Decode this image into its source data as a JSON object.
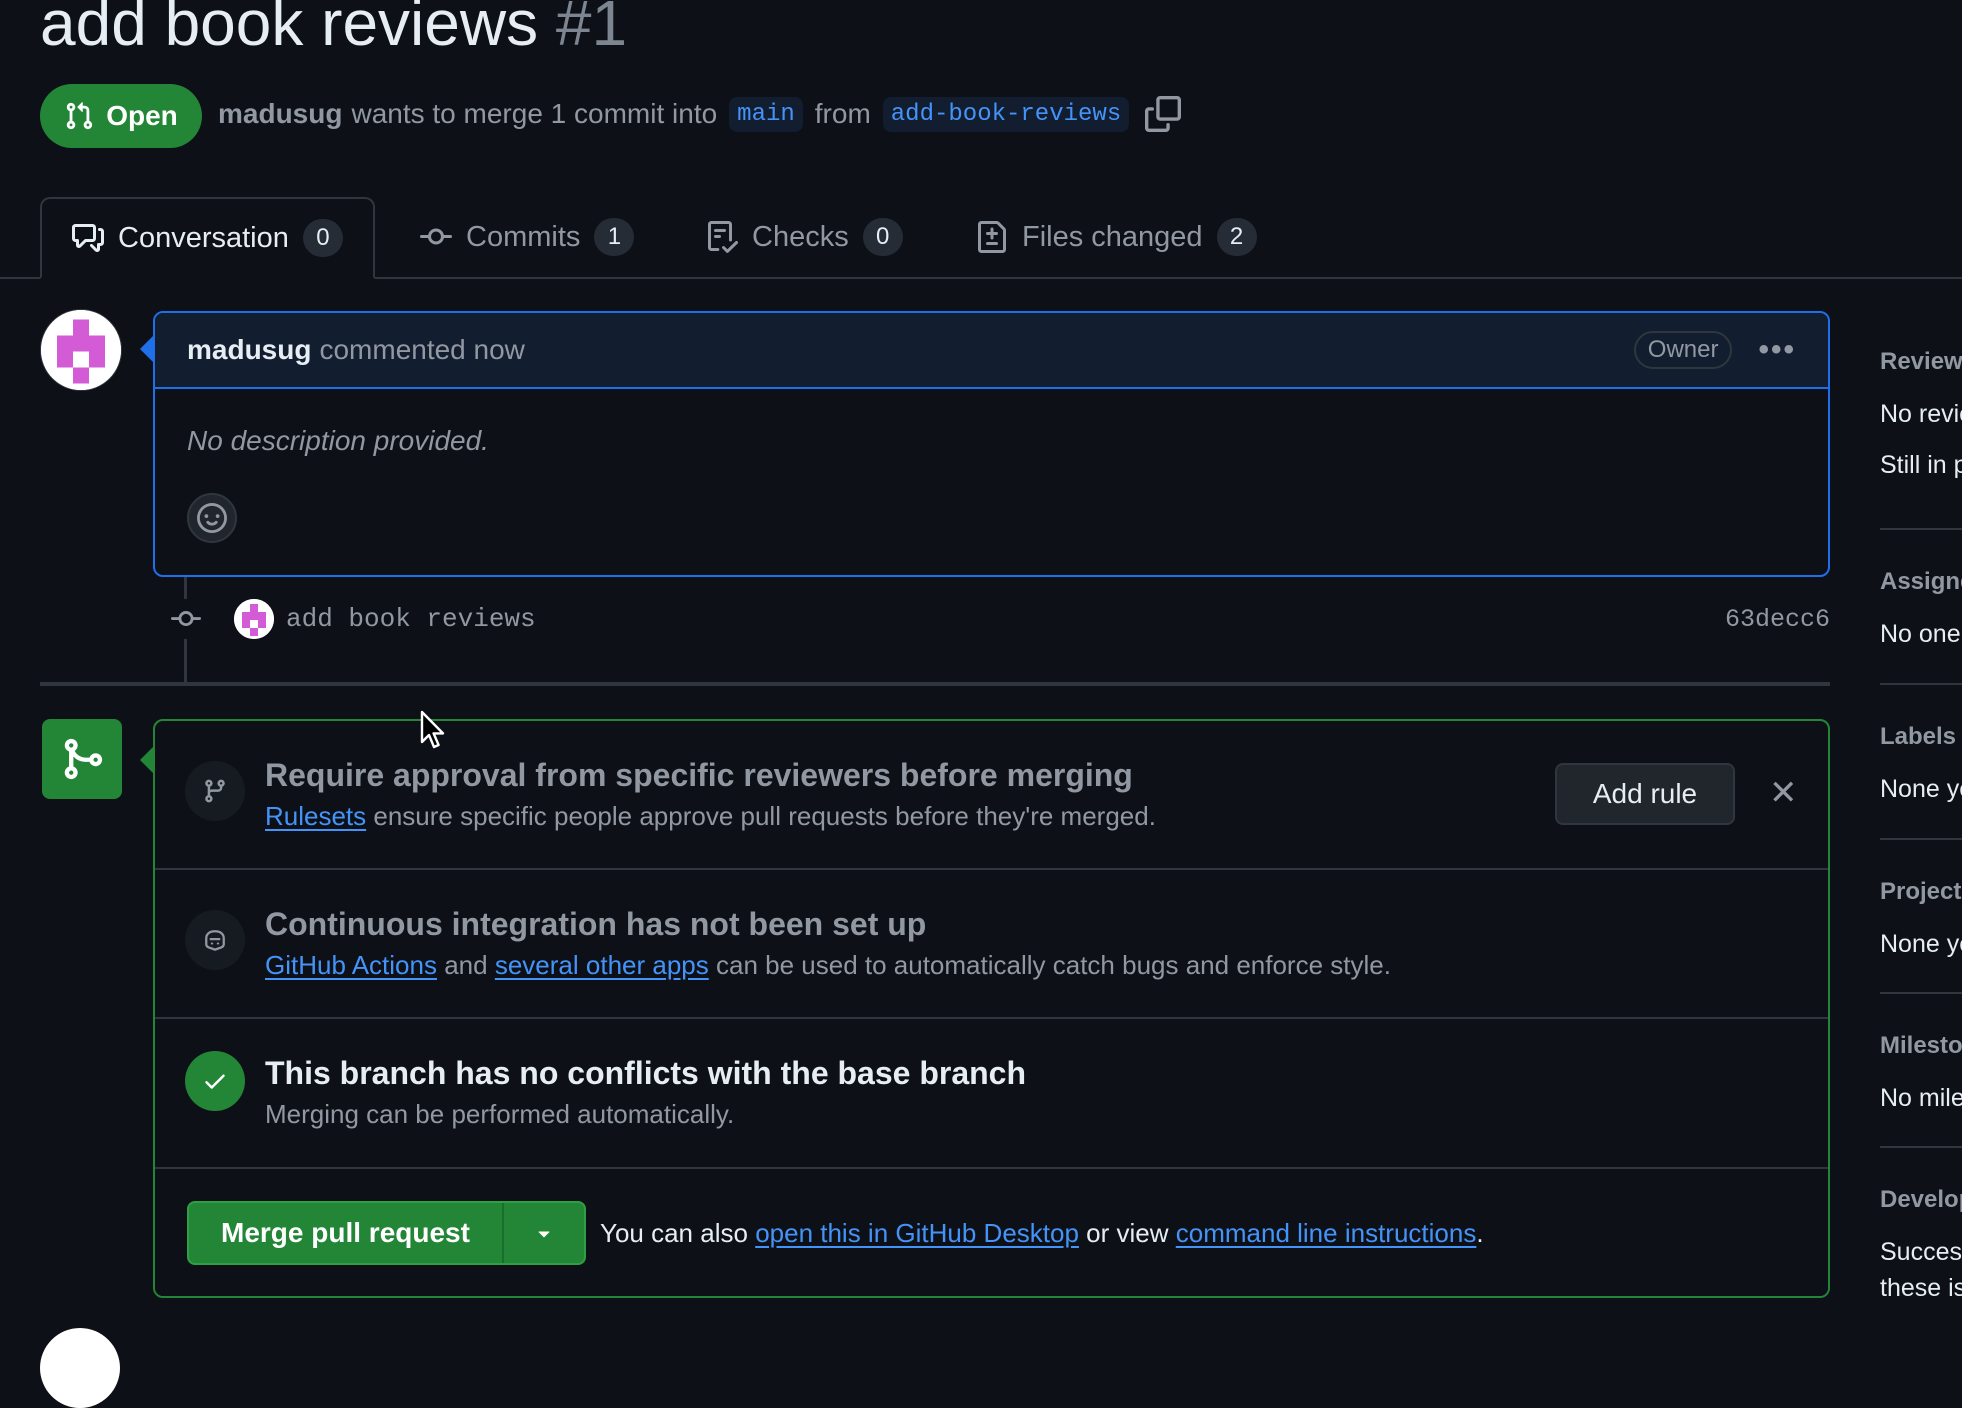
{
  "header": {
    "title": "add book reviews",
    "number": "#1",
    "state": "Open",
    "author": "madusug",
    "merge_text": "wants to merge 1 commit into",
    "base_branch": "main",
    "from_text": "from",
    "head_branch": "add-book-reviews"
  },
  "tabs": [
    {
      "label": "Conversation",
      "count": "0",
      "icon": "comment-discussion-icon"
    },
    {
      "label": "Commits",
      "count": "1",
      "icon": "git-commit-icon"
    },
    {
      "label": "Checks",
      "count": "0",
      "icon": "checklist-icon"
    },
    {
      "label": "Files changed",
      "count": "2",
      "icon": "file-diff-icon"
    }
  ],
  "comment": {
    "author": "madusug",
    "meta": "commented now",
    "role": "Owner",
    "body": "No description provided."
  },
  "commit": {
    "message": "add book reviews",
    "sha": "63decc6"
  },
  "merge_box": {
    "rule": {
      "title": "Require approval from specific reviewers before merging",
      "link": "Rulesets",
      "text": "ensure specific people approve pull requests before they're merged.",
      "button": "Add rule"
    },
    "ci": {
      "title": "Continuous integration has not been set up",
      "link1": "GitHub Actions",
      "and": "and",
      "link2": "several other apps",
      "text": "can be used to automatically catch bugs and enforce style."
    },
    "conflicts": {
      "title": "This branch has no conflicts with the base branch",
      "text": "Merging can be performed automatically."
    },
    "merge": {
      "button": "Merge pull request",
      "note_prefix": "You can also",
      "link1": "open this in GitHub Desktop",
      "middle": "or view",
      "link2": "command line instructions",
      "suffix": "."
    }
  },
  "sidebar": [
    {
      "head": "Reviewers",
      "lines": [
        "No reviews",
        "Still in progress?"
      ]
    },
    {
      "head": "Assignees",
      "lines": [
        "No one assigned"
      ]
    },
    {
      "head": "Labels",
      "lines": [
        "None yet"
      ]
    },
    {
      "head": "Projects",
      "lines": [
        "None yet"
      ]
    },
    {
      "head": "Milestone",
      "lines": [
        "No milestone"
      ]
    },
    {
      "head": "Development",
      "lines": [
        "Successfully merging this pull request may close",
        "these issues."
      ]
    }
  ],
  "colors": {
    "background": "#0d1117",
    "accent_green": "#238636",
    "link_blue": "#4493f8",
    "border": "#30363d"
  }
}
